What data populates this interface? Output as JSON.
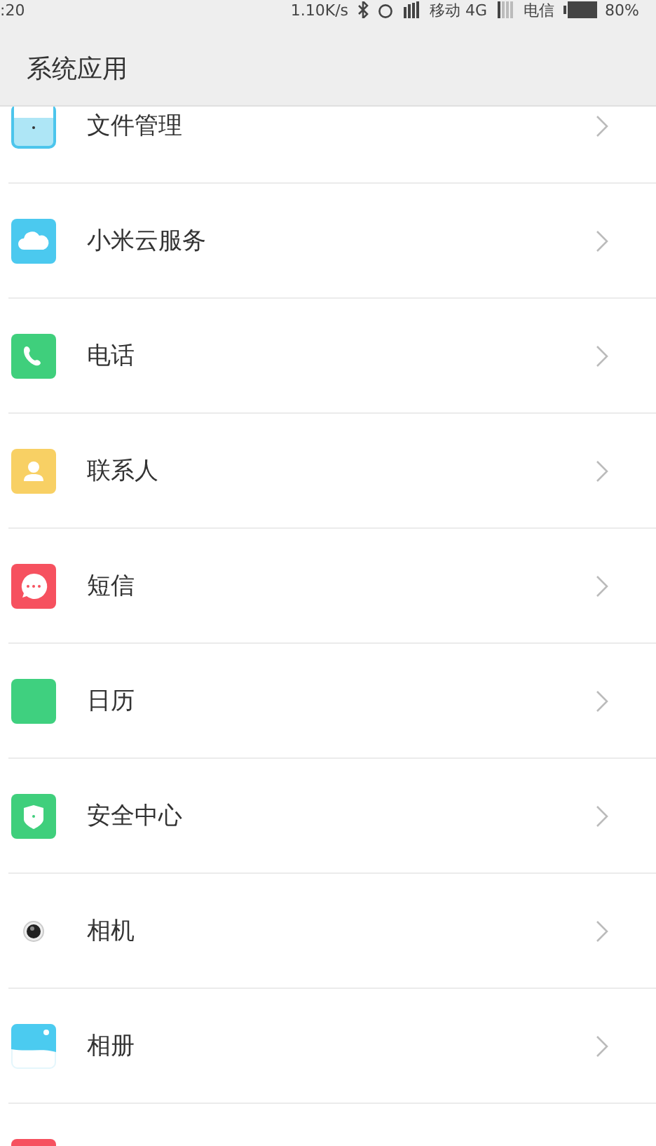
{
  "status_bar": {
    "time": ":20",
    "speed": "1.10K/s",
    "carrier_1": "移动 4G",
    "carrier_2": "电信",
    "battery": "80%"
  },
  "header": {
    "title": "系统应用"
  },
  "apps": [
    {
      "label": "文件管理",
      "kind": "folder"
    },
    {
      "label": "小米云服务",
      "kind": "cloud"
    },
    {
      "label": "电话",
      "kind": "phone"
    },
    {
      "label": "联系人",
      "kind": "contact"
    },
    {
      "label": "短信",
      "kind": "message"
    },
    {
      "label": "日历",
      "kind": "calendar"
    },
    {
      "label": "安全中心",
      "kind": "shield"
    },
    {
      "label": "相机",
      "kind": "camera"
    },
    {
      "label": "相册",
      "kind": "gallery"
    },
    {
      "kind": "tile"
    }
  ]
}
